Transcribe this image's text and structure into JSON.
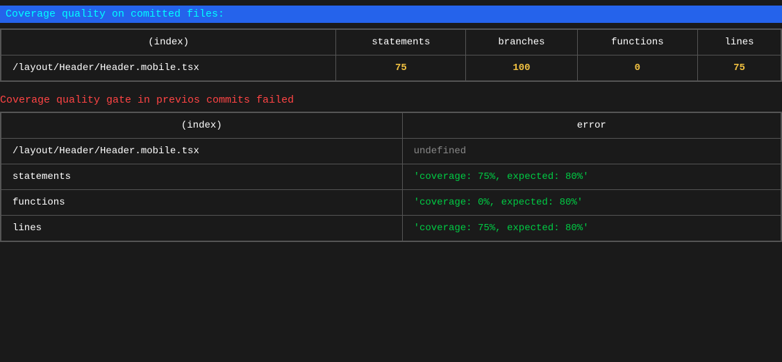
{
  "header": {
    "top_title": "Coverage quality on comitted files:",
    "gate_title": "Coverage quality gate in previos commits failed"
  },
  "quality_table": {
    "columns": [
      "(index)",
      "statements",
      "branches",
      "functions",
      "lines"
    ],
    "rows": [
      {
        "index": "/layout/Header/Header.mobile.tsx",
        "statements": "75",
        "branches": "100",
        "functions": "0",
        "lines": "75"
      }
    ]
  },
  "gate_table": {
    "columns": [
      "(index)",
      "error"
    ],
    "rows": [
      {
        "index": "/layout/Header/Header.mobile.tsx",
        "error_undefined": "undefined",
        "error_rows": [
          {
            "label": "statements",
            "value": "'coverage: 75%, expected: 80%'"
          },
          {
            "label": "functions",
            "value": "'coverage: 0%, expected: 80%'"
          },
          {
            "label": "lines",
            "value": "'coverage: 75%, expected: 80%'"
          }
        ]
      }
    ]
  }
}
